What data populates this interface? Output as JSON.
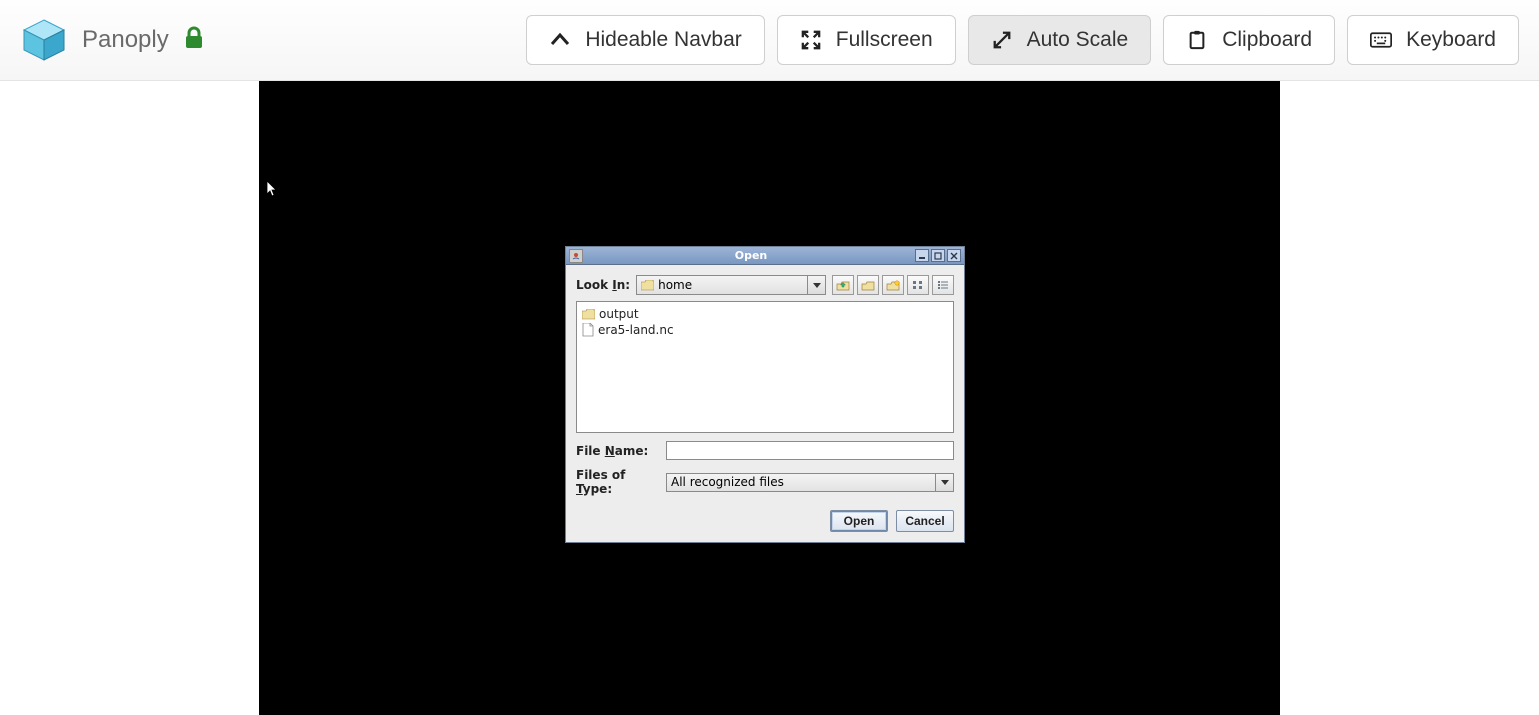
{
  "navbar": {
    "app_title": "Panoply",
    "buttons": {
      "hideable": "Hideable Navbar",
      "fullscreen": "Fullscreen",
      "autoscale": "Auto Scale",
      "clipboard": "Clipboard",
      "keyboard": "Keyboard"
    }
  },
  "dialog": {
    "title": "Open",
    "look_in_label": "Look In:",
    "look_in_value": "home",
    "items": [
      {
        "type": "folder",
        "name": "output"
      },
      {
        "type": "file",
        "name": "era5-land.nc"
      }
    ],
    "file_name_label": "File Name:",
    "file_name_value": "",
    "files_of_type_label": "Files of Type:",
    "files_of_type_value": "All recognized files",
    "open_btn": "Open",
    "cancel_btn": "Cancel"
  }
}
